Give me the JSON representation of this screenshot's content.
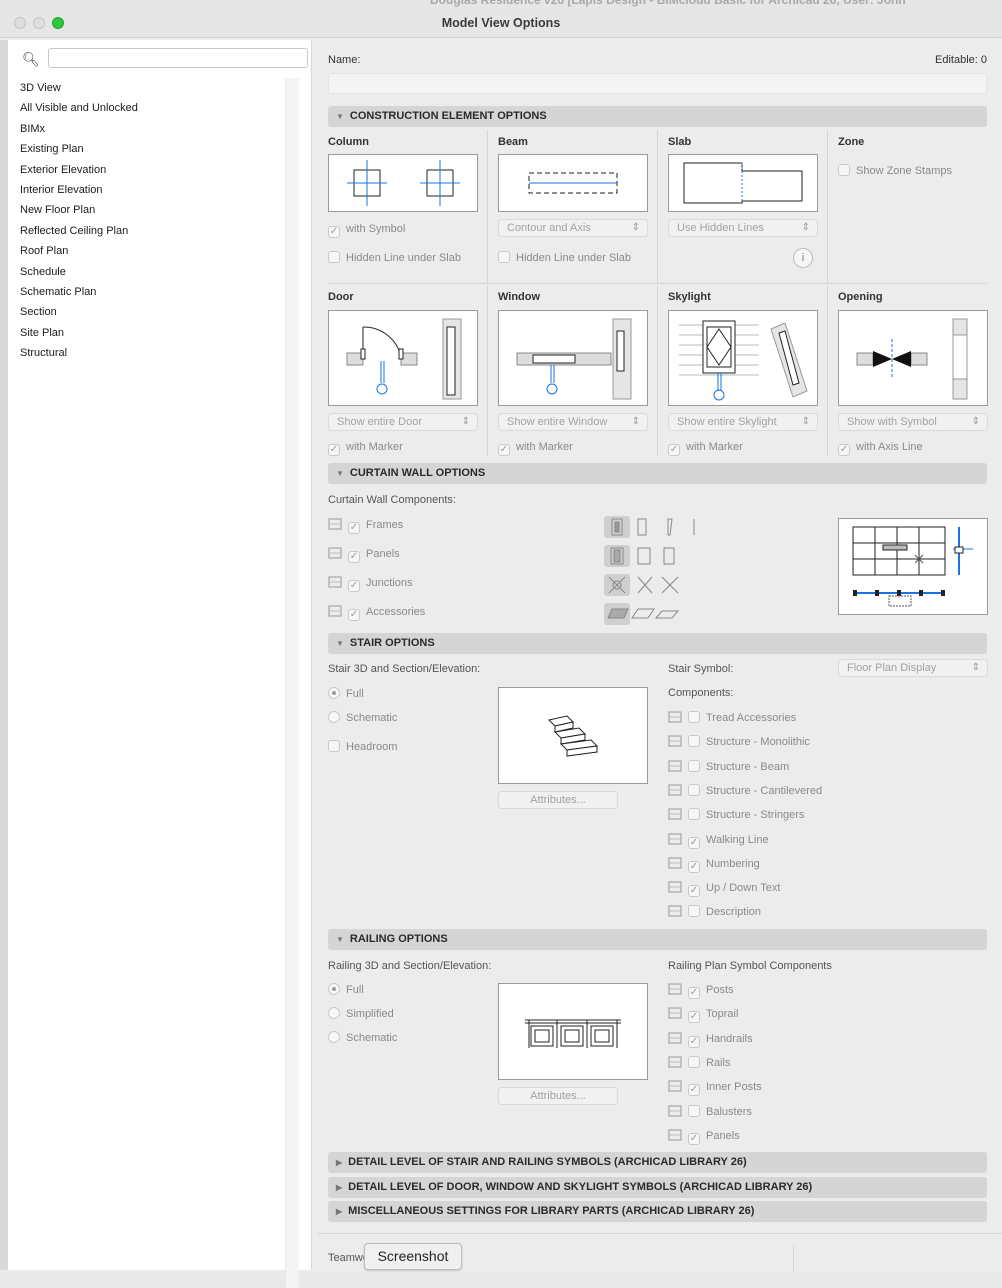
{
  "window": {
    "title": "Model View Options",
    "background_title": "Douglas Residence v26 [Lapis Design - BIMcloud Basic for Archicad 26, User: John"
  },
  "sidebar": {
    "search_placeholder": "",
    "items": [
      "3D View",
      "All Visible and Unlocked",
      "BIMx",
      "Existing Plan",
      "Exterior Elevation",
      "Interior Elevation",
      "New Floor Plan",
      "Reflected Ceiling Plan",
      "Roof Plan",
      "Schedule",
      "Schematic Plan",
      "Section",
      "Site Plan",
      "Structural"
    ]
  },
  "name_label": "Name:",
  "name_value": "",
  "editable": "Editable: 0",
  "construction": {
    "header": "CONSTRUCTION ELEMENT OPTIONS",
    "column": {
      "title": "Column",
      "with_symbol": "with Symbol",
      "with_symbol_checked": true,
      "hidden_line": "Hidden Line under Slab",
      "hidden_line_checked": false
    },
    "beam": {
      "title": "Beam",
      "select": "Contour and Axis",
      "hidden_line": "Hidden Line under Slab",
      "hidden_line_checked": false
    },
    "slab": {
      "title": "Slab",
      "select": "Use Hidden Lines",
      "info": "i"
    },
    "zone": {
      "title": "Zone",
      "show_stamps": "Show Zone Stamps",
      "show_stamps_checked": false
    },
    "door": {
      "title": "Door",
      "select": "Show entire Door",
      "marker": "with Marker"
    },
    "window": {
      "title": "Window",
      "select": "Show entire Window",
      "marker": "with Marker"
    },
    "skylight": {
      "title": "Skylight",
      "select": "Show entire Skylight",
      "marker": "with Marker"
    },
    "opening": {
      "title": "Opening",
      "select": "Show with Symbol",
      "axis": "with Axis Line"
    }
  },
  "curtain": {
    "header": "CURTAIN WALL OPTIONS",
    "components_label": "Curtain Wall Components:",
    "components": [
      {
        "label": "Frames",
        "checked": true,
        "icon": "frames-icon"
      },
      {
        "label": "Panels",
        "checked": true,
        "icon": "panels-icon"
      },
      {
        "label": "Junctions",
        "checked": true,
        "icon": "junctions-icon"
      },
      {
        "label": "Accessories",
        "checked": true,
        "icon": "accessories-icon"
      }
    ]
  },
  "stair": {
    "header": "STAIR OPTIONS",
    "label_3d": "Stair 3D and Section/Elevation:",
    "modes": [
      {
        "label": "Full",
        "selected": true
      },
      {
        "label": "Schematic",
        "selected": false
      }
    ],
    "headroom": "Headroom",
    "attributes": "Attributes...",
    "symbol_label": "Stair Symbol:",
    "symbol_select": "Floor Plan Display",
    "components_label": "Components:",
    "components": [
      {
        "label": "Tread Accessories",
        "checked": false
      },
      {
        "label": "Structure - Monolithic",
        "checked": false
      },
      {
        "label": "Structure - Beam",
        "checked": false
      },
      {
        "label": "Structure - Cantilevered",
        "checked": false
      },
      {
        "label": "Structure - Stringers",
        "checked": false
      },
      {
        "label": "Walking Line",
        "checked": true
      },
      {
        "label": "Numbering",
        "checked": true
      },
      {
        "label": "Up / Down Text",
        "checked": true
      },
      {
        "label": "Description",
        "checked": false
      }
    ]
  },
  "railing": {
    "header": "RAILING OPTIONS",
    "label_3d": "Railing 3D and Section/Elevation:",
    "modes": [
      {
        "label": "Full",
        "selected": true
      },
      {
        "label": "Simplified",
        "selected": false
      },
      {
        "label": "Schematic",
        "selected": false
      }
    ],
    "attributes": "Attributes...",
    "symbol_label": "Railing Plan Symbol Components",
    "components": [
      {
        "label": "Posts",
        "checked": true
      },
      {
        "label": "Toprail",
        "checked": true
      },
      {
        "label": "Handrails",
        "checked": true
      },
      {
        "label": "Rails",
        "checked": false
      },
      {
        "label": "Inner Posts",
        "checked": true
      },
      {
        "label": "Balusters",
        "checked": false
      },
      {
        "label": "Panels",
        "checked": true
      }
    ]
  },
  "collapsed_sections": [
    "DETAIL LEVEL OF STAIR AND RAILING SYMBOLS (ARCHICAD LIBRARY 26)",
    "DETAIL LEVEL OF DOOR, WINDOW AND SKYLIGHT SYMBOLS (ARCHICAD LIBRARY 26)",
    "MISCELLANEOUS SETTINGS FOR LIBRARY PARTS (ARCHICAD LIBRARY 26)"
  ],
  "footer": {
    "teamwork": "Teamwo",
    "tooltip": "Screenshot"
  },
  "colors": {
    "accent_green": "#2cc840",
    "blue_axis": "#1a73e8"
  }
}
